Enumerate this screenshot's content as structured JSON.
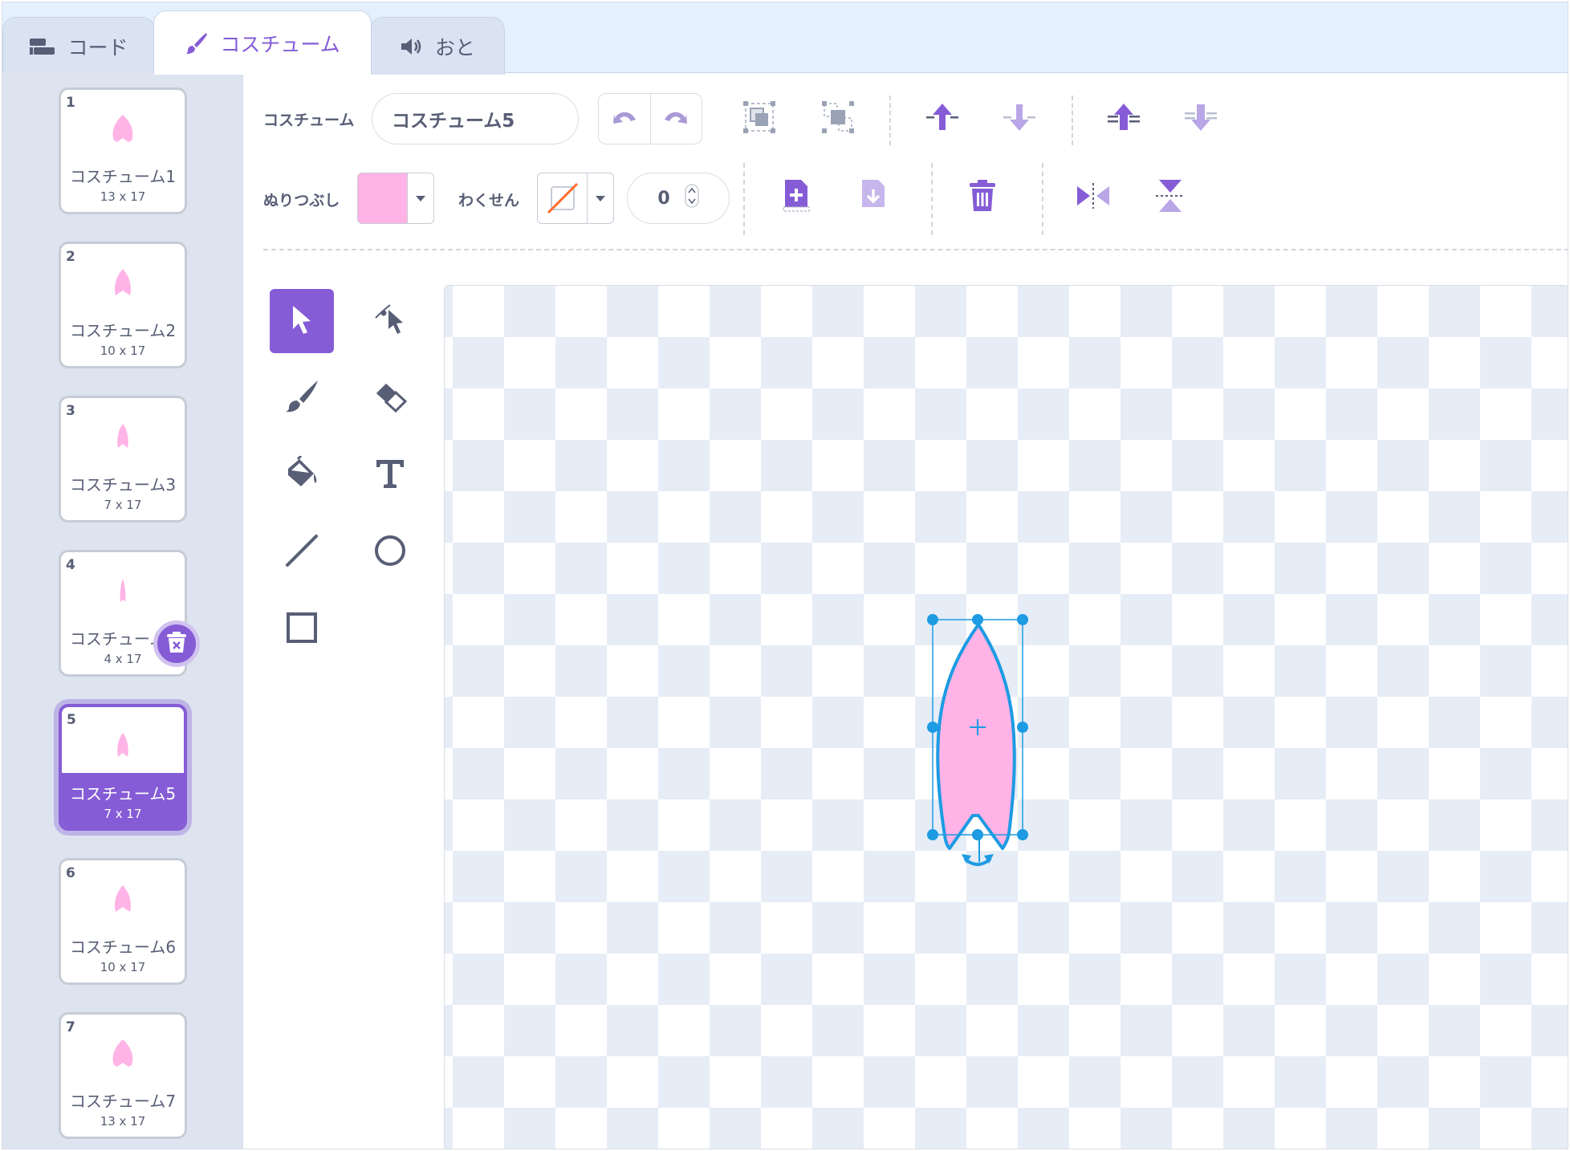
{
  "tabs": [
    {
      "label": "コード",
      "icon": "code-icon"
    },
    {
      "label": "コスチューム",
      "icon": "paintbrush-icon"
    },
    {
      "label": "おと",
      "icon": "sound-icon"
    }
  ],
  "costumes": [
    {
      "number": "1",
      "name": "コスチューム1",
      "size": "13 x 17"
    },
    {
      "number": "2",
      "name": "コスチューム2",
      "size": "10 x 17"
    },
    {
      "number": "3",
      "name": "コスチューム3",
      "size": "7 x 17"
    },
    {
      "number": "4",
      "name": "コスチューム4",
      "size": "4 x 17"
    },
    {
      "number": "5",
      "name": "コスチューム5",
      "size": "7 x 17",
      "selected": true
    },
    {
      "number": "6",
      "name": "コスチューム6",
      "size": "10 x 17"
    },
    {
      "number": "7",
      "name": "コスチューム7",
      "size": "13 x 17"
    }
  ],
  "toolbar": {
    "costume_label": "コスチューム",
    "costume_name": "コスチューム5",
    "fill_label": "ぬりつぶし",
    "outline_label": "わくせん",
    "outline_width": "0"
  },
  "colors": {
    "accent": "#855cd6",
    "fill": "#ffb3e6",
    "selection": "#1d9be3",
    "petal": "#ffb3e6"
  },
  "tools": [
    "select-tool",
    "reshape-tool",
    "brush-tool",
    "eraser-tool",
    "fill-tool",
    "text-tool",
    "line-tool",
    "circle-tool",
    "rectangle-tool"
  ]
}
